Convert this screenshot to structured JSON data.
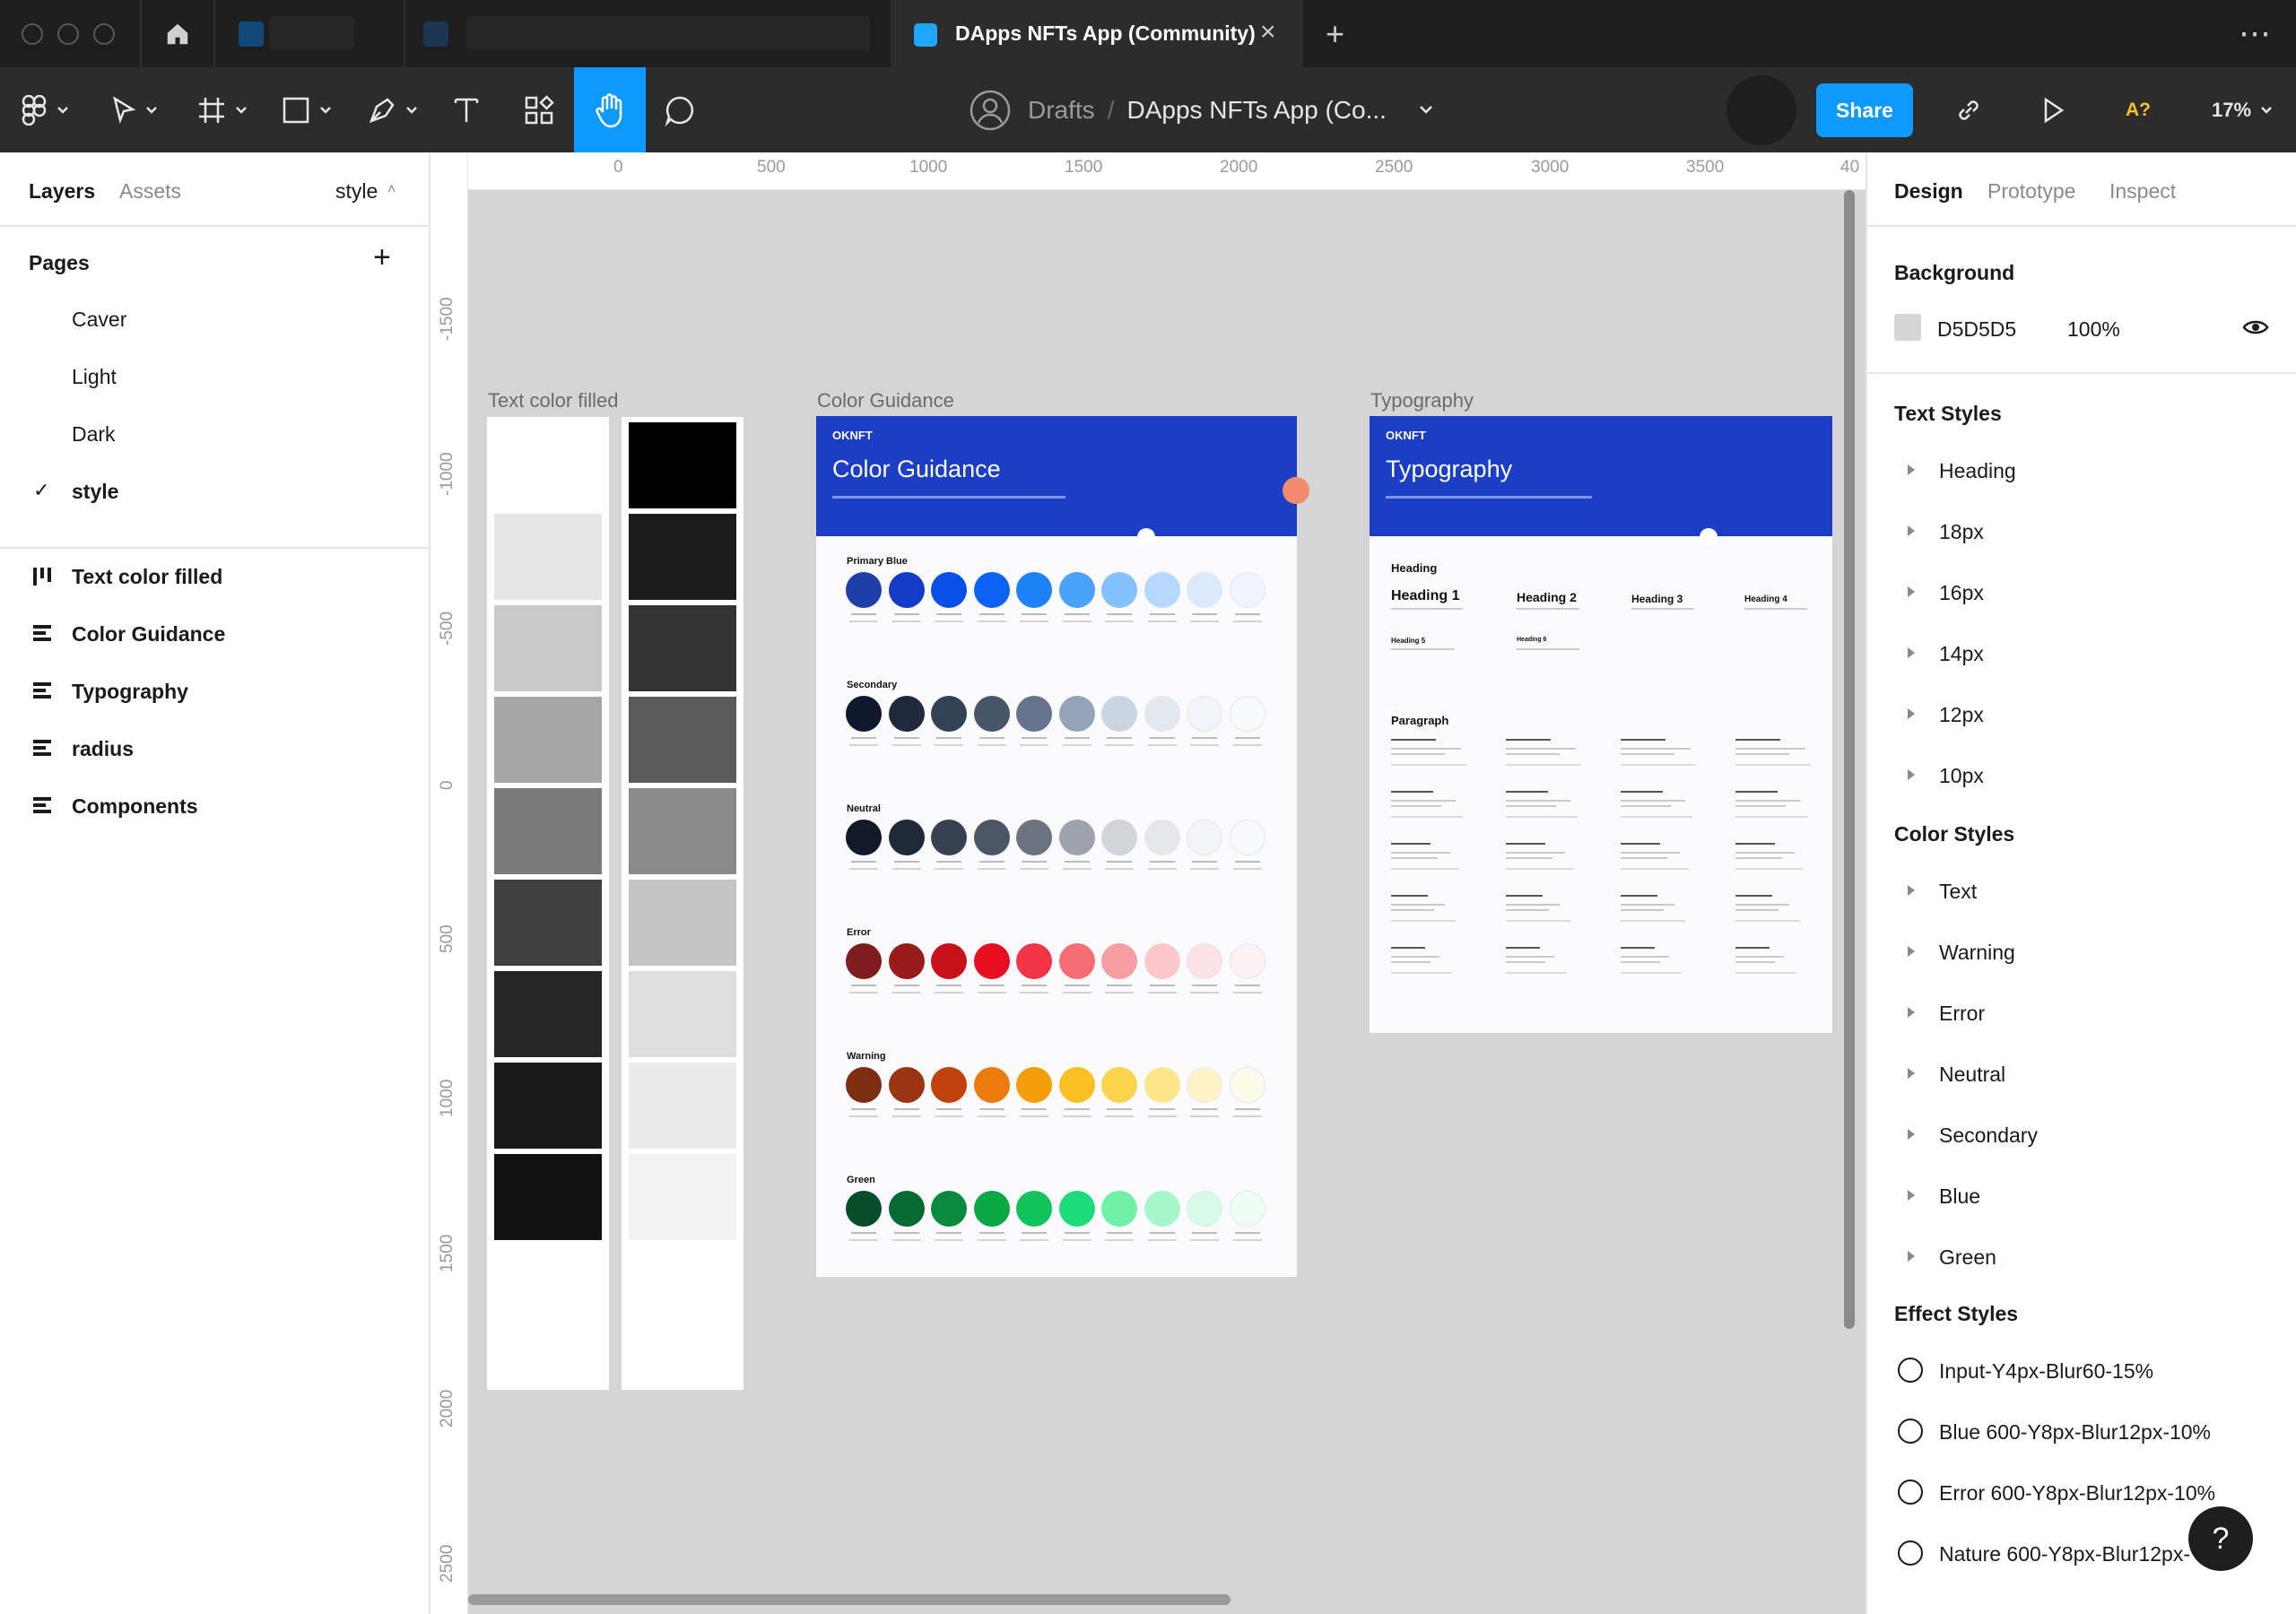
{
  "window": {
    "active_tab_title": "DApps NFTs App (Community)",
    "add_tab": "+",
    "more": "⋯"
  },
  "toolbar": {
    "breadcrumb_drafts": "Drafts",
    "breadcrumb_sep": "/",
    "file_name": "DApps NFTs App (Co...",
    "share_label": "Share",
    "font_warning": "A?",
    "zoom": "17%"
  },
  "left_panel": {
    "tabs": {
      "layers": "Layers",
      "assets": "Assets",
      "page_selector": "style"
    },
    "pages_title": "Pages",
    "pages": [
      {
        "label": "Caver",
        "checked": false
      },
      {
        "label": "Light",
        "checked": false
      },
      {
        "label": "Dark",
        "checked": false
      },
      {
        "label": "style",
        "checked": true
      }
    ],
    "check_mark": "✓",
    "layers": [
      {
        "label": "Text color filled",
        "icon": "columns-icon"
      },
      {
        "label": "Color Guidance",
        "icon": "rows-icon"
      },
      {
        "label": "Typography",
        "icon": "rows-icon"
      },
      {
        "label": "radius",
        "icon": "rows-icon"
      },
      {
        "label": "Components",
        "icon": "rows-icon"
      }
    ]
  },
  "canvas": {
    "background": "#d5d5d5",
    "ruler_top": [
      "0",
      "500",
      "1000",
      "1500",
      "2000",
      "2500",
      "3000",
      "3500",
      "40"
    ],
    "ruler_left": [
      "-1500",
      "-1000",
      "-500",
      "0",
      "500",
      "1000",
      "1500",
      "2000",
      "2500"
    ],
    "frames": {
      "text_color_filled": "Text color filled",
      "color_guidance": "Color Guidance",
      "typography": "Typography"
    },
    "light_swatches": [
      "#ffffff",
      "#e6e6e6",
      "#c9c9c9",
      "#a6a6a6",
      "#7a7a7a",
      "#3f3f3f",
      "#262626",
      "#1a1a1a",
      "#111111"
    ],
    "dark_swatches": [
      "#000000",
      "#1c1c1c",
      "#333333",
      "#5a5a5a",
      "#8a8a8a",
      "#c4c4c4",
      "#dedede",
      "#ebebeb",
      "#f2f2f2"
    ],
    "color_guidance": {
      "logo": "OKNFT",
      "title": "Color Guidance",
      "sections": [
        {
          "name": "Primary Blue",
          "colors": [
            "#1e3faa",
            "#143ac8",
            "#0a4ee8",
            "#0b63f5",
            "#1d82f7",
            "#4aa3fa",
            "#84c0fb",
            "#b6d8fc",
            "#dce9fd",
            "#eef5fe"
          ]
        },
        {
          "name": "Secondary",
          "colors": [
            "#0f172e",
            "#1e293b",
            "#334155",
            "#475569",
            "#64748b",
            "#94a3b8",
            "#cbd5e1",
            "#e2e8f0",
            "#f1f5f9",
            "#f8fafc"
          ]
        },
        {
          "name": "Neutral",
          "colors": [
            "#111827",
            "#1f2937",
            "#374151",
            "#4b5563",
            "#6b7280",
            "#9ca3af",
            "#d1d5db",
            "#e5e7eb",
            "#f3f4f6",
            "#f9fafb"
          ]
        },
        {
          "name": "Error",
          "colors": [
            "#7f1d1d",
            "#991b1b",
            "#c8101a",
            "#e80d21",
            "#f33447",
            "#f56c72",
            "#f79ea2",
            "#fbc7ca",
            "#fde2e4",
            "#fef1f2"
          ]
        },
        {
          "name": "Warning",
          "colors": [
            "#7c2d12",
            "#9a3412",
            "#c2410c",
            "#ea7b0c",
            "#f59e0b",
            "#fbbf24",
            "#fcd34d",
            "#fde68a",
            "#fef3c7",
            "#fffbeb"
          ]
        },
        {
          "name": "Green",
          "colors": [
            "#064e2b",
            "#066a33",
            "#0a8a3c",
            "#0aa845",
            "#10c35a",
            "#1fdc7a",
            "#6ef0a9",
            "#a7f5cb",
            "#d6fbe7",
            "#effdf5"
          ]
        }
      ]
    },
    "typography": {
      "logo": "OKNFT",
      "title": "Typography",
      "heading_section": "Heading",
      "headings": [
        "Heading 1",
        "Heading 2",
        "Heading 3",
        "Heading 4"
      ],
      "small_headings": [
        "Heading 5",
        "Heading 6"
      ],
      "paragraph_section": "Paragraph",
      "paragraph_groups": [
        "Paragraph XLarge",
        "Paragraph Large",
        "Paragraph Medium",
        "Paragraph Small",
        "Paragraph XSmall"
      ]
    }
  },
  "right_panel": {
    "tabs": {
      "design": "Design",
      "prototype": "Prototype",
      "inspect": "Inspect"
    },
    "background_title": "Background",
    "background_hex": "D5D5D5",
    "background_opacity": "100%",
    "text_styles_title": "Text Styles",
    "text_styles": [
      "Heading",
      "18px",
      "16px",
      "14px",
      "12px",
      "10px"
    ],
    "color_styles_title": "Color Styles",
    "color_styles": [
      "Text",
      "Warning",
      "Error",
      "Neutral",
      "Secondary",
      "Blue",
      "Green"
    ],
    "effect_styles_title": "Effect Styles",
    "effect_styles": [
      "Input-Y4px-Blur60-15%",
      "Blue 600-Y8px-Blur12px-10%",
      "Error 600-Y8px-Blur12px-10%",
      "Nature 600-Y8px-Blur12px-"
    ]
  },
  "help_label": "?"
}
